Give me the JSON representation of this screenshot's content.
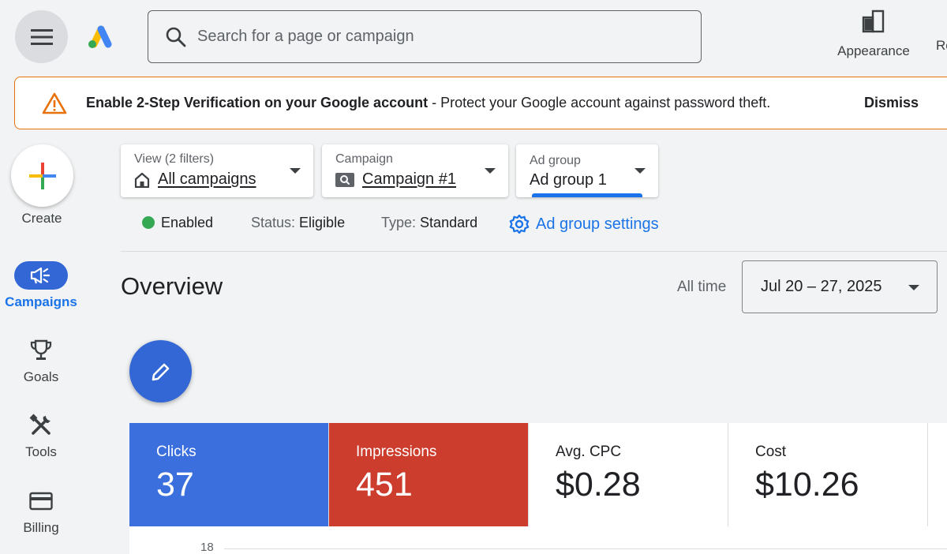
{
  "search": {
    "placeholder": "Search for a page or campaign"
  },
  "header": {
    "appearance_label": "Appearance",
    "cut_label": "Re"
  },
  "banner": {
    "title": "Enable 2-Step Verification on your Google account",
    "text": " - Protect your Google account against password theft.",
    "dismiss_label": "Dismiss"
  },
  "nav": {
    "create_label": "Create",
    "items": [
      {
        "label": "Campaigns",
        "icon": "campaigns-megaphone-icon",
        "active": true
      },
      {
        "label": "Goals",
        "icon": "trophy-icon"
      },
      {
        "label": "Tools",
        "icon": "tools-icon"
      },
      {
        "label": "Billing",
        "icon": "credit-card-icon"
      }
    ]
  },
  "filters": {
    "view": {
      "caption": "View (2 filters)",
      "value": "All campaigns"
    },
    "campaign": {
      "caption": "Campaign",
      "value": "Campaign #1"
    },
    "ad_group": {
      "caption": "Ad group",
      "value": "Ad group 1"
    }
  },
  "status": {
    "enabled": "Enabled",
    "status_label": "Status:",
    "status_value": "Eligible",
    "type_label": "Type:",
    "type_value": "Standard",
    "settings_link": "Ad group settings"
  },
  "overview": {
    "title": "Overview",
    "range_label": "All time",
    "date_range": "Jul 20 – 27, 2025"
  },
  "metrics": [
    {
      "label": "Clicks",
      "value": "37"
    },
    {
      "label": "Impressions",
      "value": "451"
    },
    {
      "label": "Avg. CPC",
      "value": "$0.28"
    },
    {
      "label": "Cost",
      "value": "$10.26"
    }
  ],
  "chart": {
    "top_tick": "18"
  },
  "colors": {
    "accent": "#1a73e8",
    "clicks": "#3b6fde",
    "impressions": "#cc3d2e",
    "warning": "#e8710a",
    "enabled": "#34a853"
  }
}
